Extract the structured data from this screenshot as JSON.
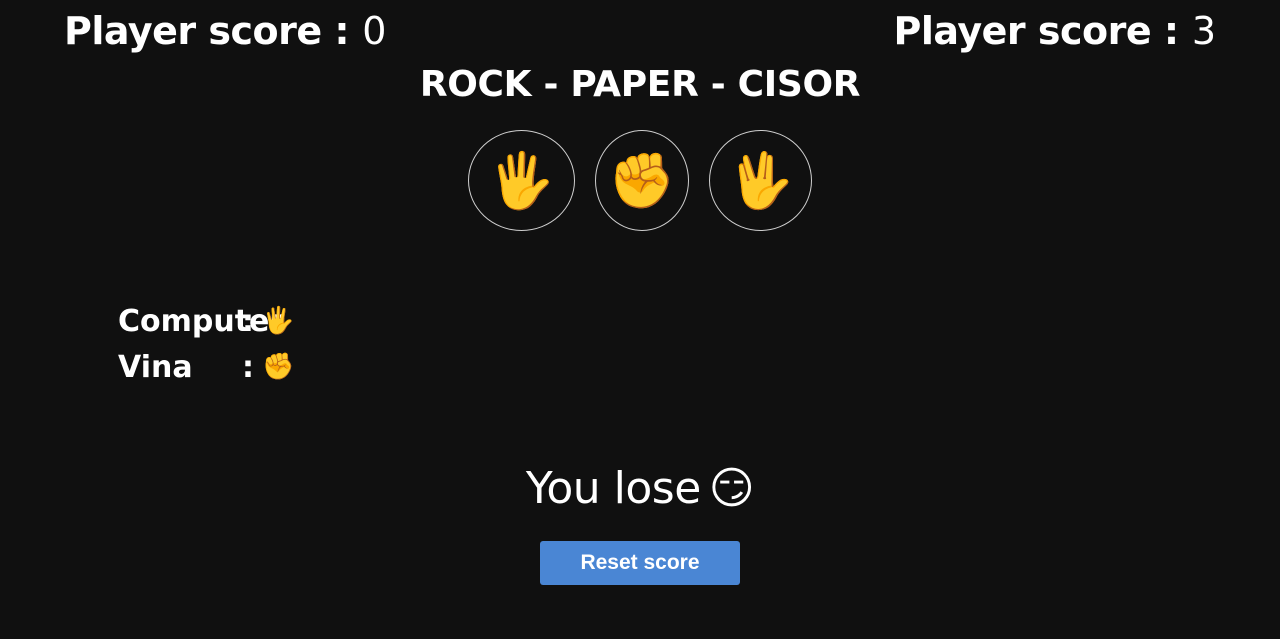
{
  "scoreboard": {
    "left": {
      "label": "Player score :",
      "value": "0"
    },
    "right": {
      "label": "Player score :",
      "value": "3"
    }
  },
  "title": "ROCK - PAPER - CISOR",
  "choices": [
    {
      "emoji": "🖐",
      "icon": "hand-paper-icon"
    },
    {
      "emoji": "✊",
      "icon": "fist-rock-icon"
    },
    {
      "emoji": "🖖",
      "icon": "vulcan-scissors-icon"
    }
  ],
  "players": {
    "computer": {
      "name": "Computer",
      "separator": ":",
      "choice": "🖐"
    },
    "human": {
      "name": "Vina",
      "separator": ":",
      "choice": "✊"
    }
  },
  "result": {
    "text": "You lose",
    "emoji": "😏"
  },
  "reset_button": "Reset score"
}
